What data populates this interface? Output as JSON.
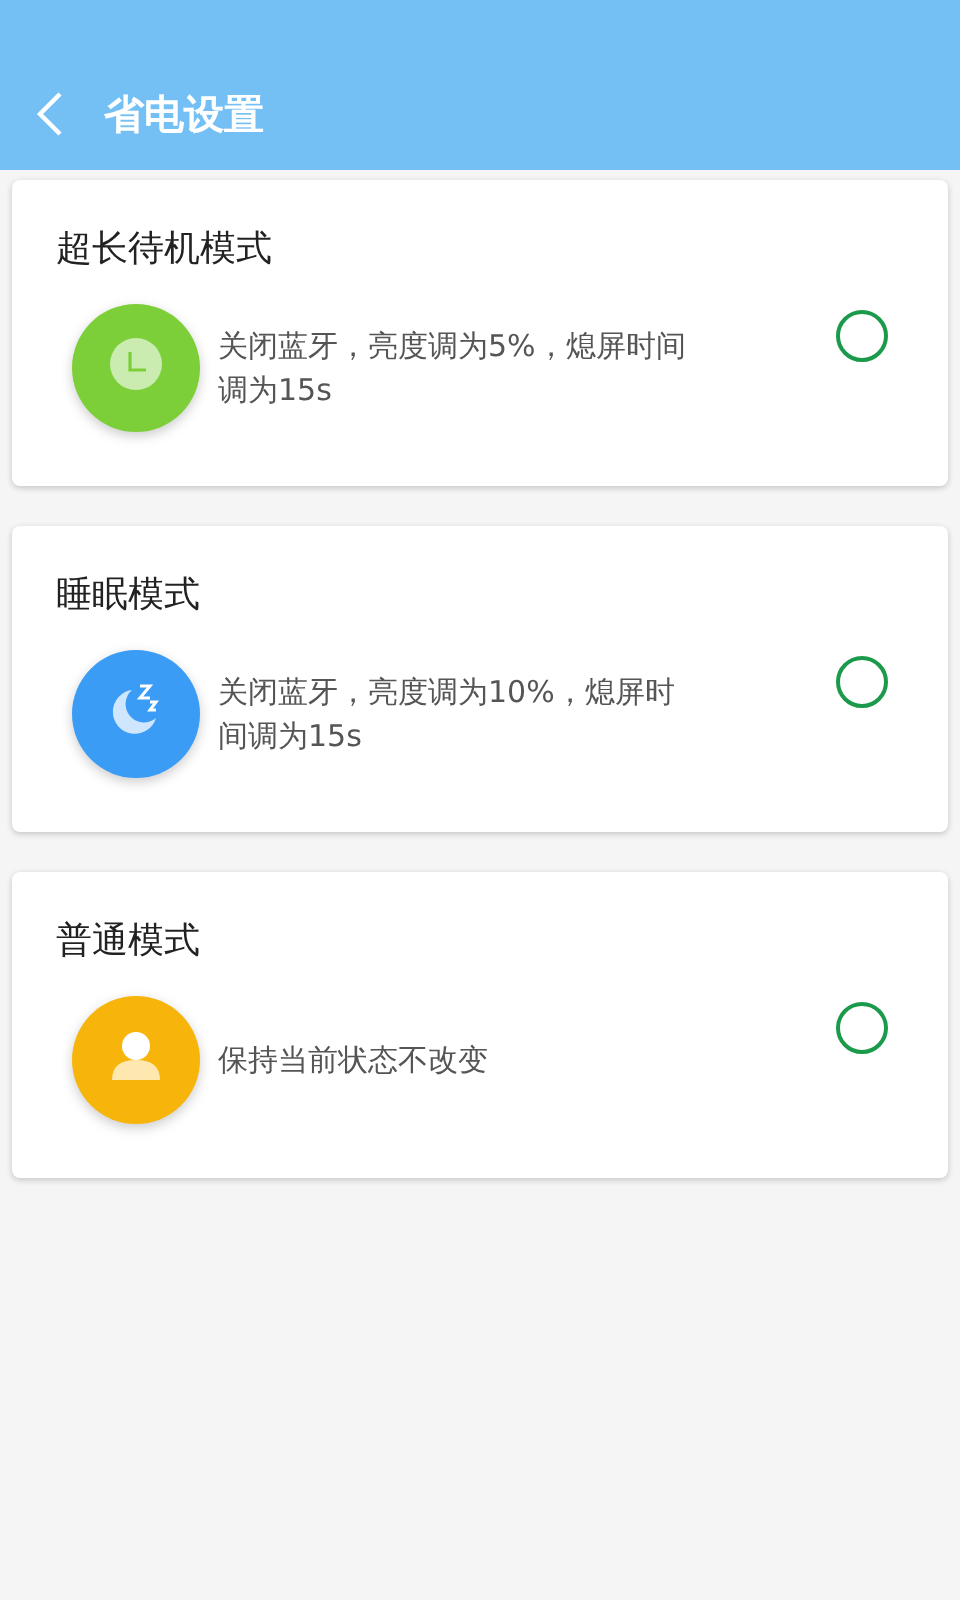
{
  "header": {
    "title": "省电设置"
  },
  "modes": [
    {
      "title": "超长待机模式",
      "description": "关闭蓝牙，亮度调为5%，熄屏时间调为15s",
      "kind": "clock",
      "color": "#7dcf3a",
      "selected": false
    },
    {
      "title": "睡眠模式",
      "description": "关闭蓝牙，亮度调为10%，熄屏时间调为15s",
      "kind": "moon",
      "color": "#3a9cf5",
      "selected": false
    },
    {
      "title": "普通模式",
      "description": "保持当前状态不改变",
      "kind": "person",
      "color": "#f7b50c",
      "selected": false
    }
  ]
}
